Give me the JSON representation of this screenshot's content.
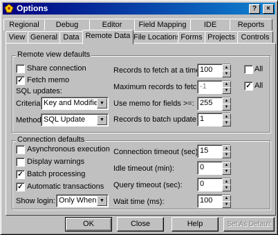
{
  "window": {
    "title": "Options"
  },
  "title_buttons": {
    "help": "?",
    "close": "×"
  },
  "tabs_row1": [
    "Regional",
    "Debug",
    "Editor",
    "Field Mapping",
    "IDE",
    "Reports"
  ],
  "tabs_row2": [
    "View",
    "General",
    "Data",
    "Remote Data",
    "File Locations",
    "Forms",
    "Projects",
    "Controls"
  ],
  "remote": {
    "group_label": "Remote view defaults",
    "share_connection": {
      "label": "Share connection",
      "checked": false
    },
    "fetch_memo": {
      "label": "Fetch memo",
      "checked": true
    },
    "sql_updates": "SQL updates:",
    "criteria_label": "Criteria:",
    "criteria_value": "Key and Modified F",
    "method_label": "Method:",
    "method_value": "SQL Update",
    "records_fetch_label": "Records to fetch at a time:",
    "records_fetch_value": "100",
    "records_fetch_all": {
      "label": "All",
      "checked": false
    },
    "max_records_label": "Maximum records to fetch:",
    "max_records_value": "-1",
    "max_records_all": {
      "label": "All",
      "checked": true
    },
    "memo_fields_label": "Use memo for fields >=:",
    "memo_fields_value": "255",
    "batch_update_label": "Records to batch update:",
    "batch_update_value": "1"
  },
  "connection": {
    "group_label": "Connection defaults",
    "async": {
      "label": "Asynchronous execution",
      "checked": false
    },
    "warnings": {
      "label": "Display warnings",
      "checked": false
    },
    "batch": {
      "label": "Batch processing",
      "checked": true
    },
    "auto_tx": {
      "label": "Automatic transactions",
      "checked": true
    },
    "show_login_label": "Show login:",
    "show_login_value": "Only When N",
    "conn_timeout_label": "Connection timeout (sec):",
    "conn_timeout_value": "15",
    "idle_timeout_label": "Idle timeout (min):",
    "idle_timeout_value": "0",
    "query_timeout_label": "Query timeout (sec):",
    "query_timeout_value": "0",
    "wait_time_label": "Wait time (ms):",
    "wait_time_value": "100"
  },
  "buttons": {
    "ok": "OK",
    "close": "Close",
    "help": "Help",
    "set_default": "Set As Default"
  },
  "check_glyph": "✓"
}
